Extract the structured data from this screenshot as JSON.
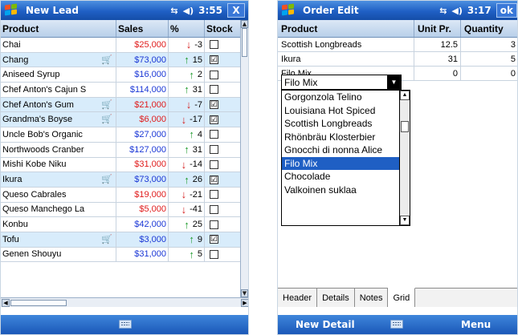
{
  "screen1": {
    "title": "New Lead",
    "time": "3:55",
    "close_label": "X",
    "columns": [
      "Product",
      "Sales",
      "%",
      "Stock"
    ],
    "rows": [
      {
        "product": "Chai",
        "sales": "$25,000",
        "trend": "down",
        "pct": "-3",
        "stock": "",
        "cart": false
      },
      {
        "product": "Chang",
        "sales": "$73,000",
        "trend": "up",
        "pct": "15",
        "stock": "☑",
        "cart": true
      },
      {
        "product": "Aniseed Syrup",
        "sales": "$16,000",
        "trend": "up",
        "pct": "2",
        "stock": "",
        "cart": false
      },
      {
        "product": "Chef Anton's Cajun S",
        "sales": "$114,000",
        "trend": "up",
        "pct": "31",
        "stock": "",
        "cart": false
      },
      {
        "product": "Chef Anton's Gum",
        "sales": "$21,000",
        "trend": "down",
        "pct": "-7",
        "stock": "☑",
        "cart": true
      },
      {
        "product": "Grandma's Boyse",
        "sales": "$6,000",
        "trend": "down",
        "pct": "-17",
        "stock": "☑",
        "cart": true
      },
      {
        "product": "Uncle Bob's Organic",
        "sales": "$27,000",
        "trend": "up",
        "pct": "4",
        "stock": "",
        "cart": false
      },
      {
        "product": "Northwoods Cranber",
        "sales": "$127,000",
        "trend": "up",
        "pct": "31",
        "stock": "",
        "cart": false
      },
      {
        "product": "Mishi Kobe Niku",
        "sales": "$31,000",
        "trend": "down",
        "pct": "-14",
        "stock": "",
        "cart": false
      },
      {
        "product": "Ikura",
        "sales": "$73,000",
        "trend": "up",
        "pct": "26",
        "stock": "☑",
        "cart": true
      },
      {
        "product": "Queso Cabrales",
        "sales": "$19,000",
        "trend": "down",
        "pct": "-21",
        "stock": "",
        "cart": false
      },
      {
        "product": "Queso Manchego La",
        "sales": "$5,000",
        "trend": "down",
        "pct": "-41",
        "stock": "",
        "cart": false
      },
      {
        "product": "Konbu",
        "sales": "$42,000",
        "trend": "up",
        "pct": "25",
        "stock": "",
        "cart": false
      },
      {
        "product": "Tofu",
        "sales": "$3,000",
        "trend": "up",
        "pct": "9",
        "stock": "☑",
        "cart": true
      },
      {
        "product": "Genen Shouyu",
        "sales": "$31,000",
        "trend": "up",
        "pct": "5",
        "stock": "",
        "cart": false
      }
    ]
  },
  "screen2": {
    "title": "Order Edit",
    "time": "3:17",
    "ok_label": "ok",
    "columns": [
      "Product",
      "Unit Pr.",
      "Quantity"
    ],
    "rows": [
      {
        "product": "Scottish Longbreads",
        "unit": "12.5",
        "qty": "3"
      },
      {
        "product": "Ikura",
        "unit": "31",
        "qty": "5"
      },
      {
        "product": "Filo Mix",
        "unit": "0",
        "qty": "0"
      }
    ],
    "combo_value": "Filo Mix",
    "dropdown_items": [
      "Gorgonzola Telino",
      "Louisiana Hot Spiced",
      "Scottish Longbreads",
      "Rhönbräu Klosterbier",
      "Gnocchi di nonna Alice",
      "Filo Mix",
      "Chocolade",
      "Valkoinen suklaa"
    ],
    "dropdown_selected": "Filo Mix",
    "tabs": [
      "Header",
      "Details",
      "Notes",
      "Grid"
    ],
    "active_tab": "Grid",
    "softkey_left": "New Detail",
    "softkey_right": "Menu"
  },
  "colors": {
    "title_bar": "#1f5fc4",
    "sales_up": "#1a37d6",
    "sales_down": "#e01b1b",
    "arrow_up": "#1e9b2c",
    "arrow_down": "#d51d1d",
    "selected_row": "#d8ecfb"
  },
  "icons": [
    "windows-logo-icon",
    "connectivity-icon",
    "speaker-icon",
    "close-icon",
    "cart-icon",
    "keyboard-icon"
  ]
}
